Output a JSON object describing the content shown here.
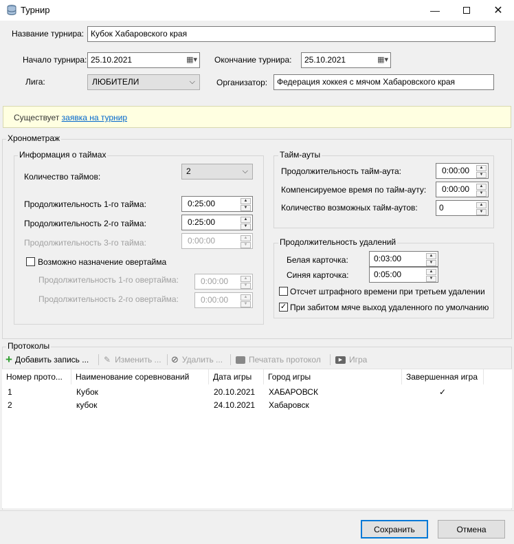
{
  "window": {
    "title": "Турнир",
    "minimize_icon": "minimize-icon",
    "maximize_icon": "maximize-icon",
    "close_icon": "close-icon"
  },
  "tournament": {
    "name_label": "Название турнира:",
    "name_value": "Кубок Хабаровского края",
    "start_label": "Начало турнира:",
    "start_value": "25.10.2021",
    "end_label": "Окончание турнира:",
    "end_value": "25.10.2021",
    "league_label": "Лига:",
    "league_value": "ЛЮБИТЕЛИ",
    "organizer_label": "Организатор:",
    "organizer_value": "Федерация хоккея с мячом Хабаровского края"
  },
  "notice": {
    "text": "Существует ",
    "link": "заявка на турнир",
    "background": "#ffffe1"
  },
  "timing": {
    "title": "Хронометраж",
    "periods": {
      "title": "Информация о таймах",
      "count_label": "Количество таймов:",
      "count_value": "2",
      "p1_label": "Продолжительность 1-го тайма:",
      "p1_value": "0:25:00",
      "p2_label": "Продолжительность 2-го тайма:",
      "p2_value": "0:25:00",
      "p3_label": "Продолжительность 3-го тайма:",
      "p3_value": "0:00:00",
      "overtime_label": "Возможно назначение овертайма",
      "overtime_checked": false,
      "ot1_label": "Продолжительность 1-го овертайма:",
      "ot1_value": "0:00:00",
      "ot2_label": "Продолжительность 2-го овертайма:",
      "ot2_value": "0:00:00"
    },
    "timeouts": {
      "title": "Тайм-ауты",
      "duration_label": "Продолжительность тайм-аута:",
      "duration_value": "0:00:00",
      "compensated_label": "Компенсируемое время по тайм-ауту:",
      "compensated_value": "0:00:00",
      "count_label": "Количество возможных тайм-аутов:",
      "count_value": "0"
    },
    "penalties": {
      "title": "Продолжительность удалений",
      "white_label": "Белая карточка:",
      "white_value": "0:03:00",
      "blue_label": "Синяя карточка:",
      "blue_value": "0:05:00",
      "third_penalty_label": "Отсчет штрафного времени при третьем удалении",
      "third_penalty_checked": false,
      "goal_exit_label": "При забитом мяче выход удаленного по умолчанию",
      "goal_exit_checked": true
    }
  },
  "protocols": {
    "title": "Протоколы",
    "toolbar": {
      "add": "Добавить запись ...",
      "edit": "Изменить ...",
      "delete": "Удалить ...",
      "print": "Печатать протокол",
      "game": "Игра"
    },
    "columns": [
      "Номер прото...",
      "Наименование соревнований",
      "Дата игры",
      "Город игры",
      "Завершенная игра"
    ],
    "rows": [
      {
        "number": "1",
        "name": "Кубок",
        "date": "20.10.2021",
        "city": "ХАБАРОВСК",
        "completed": "✓"
      },
      {
        "number": "2",
        "name": "кубок",
        "date": "24.10.2021",
        "city": "Хабаровск",
        "completed": ""
      }
    ]
  },
  "buttons": {
    "save": "Сохранить",
    "cancel": "Отмена"
  },
  "colors": {
    "accent": "#0078d7",
    "link": "#0066cc",
    "add_icon": "#2e9e2e"
  }
}
